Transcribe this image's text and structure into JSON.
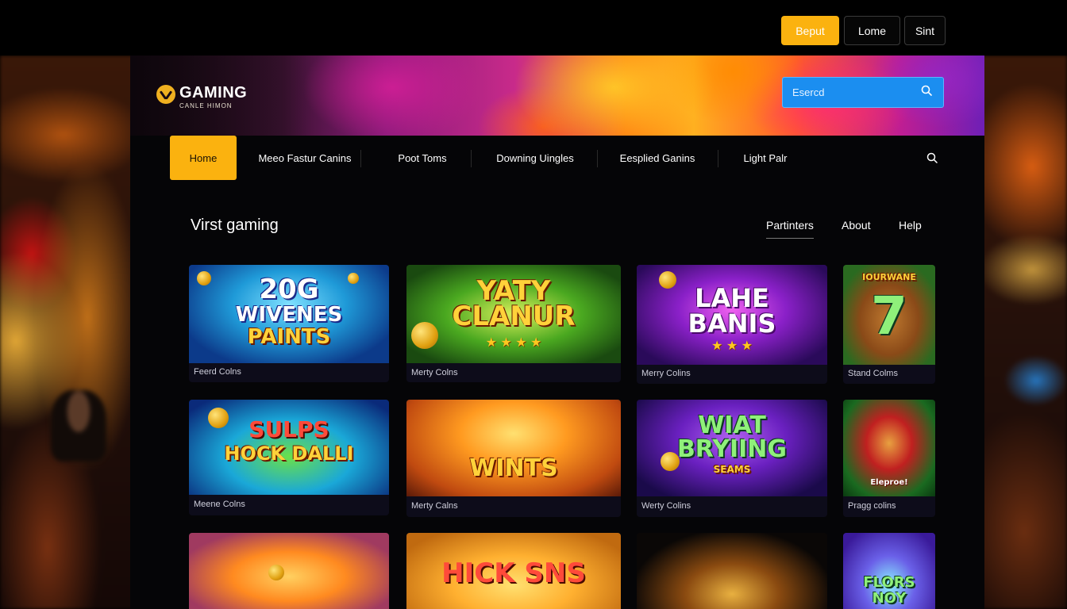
{
  "topbar": {
    "buttons": [
      "Beput",
      "Lome",
      "Sint"
    ]
  },
  "brand": {
    "title": "GAMING",
    "subtitle": "CANLE HIMON"
  },
  "search": {
    "placeholder": "Esercd"
  },
  "nav": {
    "items": [
      "Home",
      "Meeo Fastur Canins",
      "Poot Toms",
      "Downing Uingles",
      "Eesplied Ganins",
      "Light Palr"
    ],
    "active_index": 0
  },
  "section": {
    "title": "Virst gaming",
    "links": [
      "Partinters",
      "About",
      "Help"
    ]
  },
  "games": [
    {
      "art_lines": [
        "20G",
        "WIVENES",
        "PAINTS"
      ],
      "caption": "Feerd Colns"
    },
    {
      "art_lines": [
        "YATY",
        "CLANUR"
      ],
      "caption": "Merty Colns"
    },
    {
      "art_lines": [
        "LAHE",
        "BANIS"
      ],
      "caption": "Merry Colins"
    },
    {
      "art_lines": [
        "IOURWANE",
        "7"
      ],
      "caption": "Stand Colms"
    },
    {
      "art_lines": [
        "SULPS",
        "HOCK DALLI"
      ],
      "caption": "Meene Colns"
    },
    {
      "art_lines": [
        "WINTS"
      ],
      "caption": "Merty Calns"
    },
    {
      "art_lines": [
        "WIAT",
        "BRYIING",
        "SEAMS"
      ],
      "caption": "Werty Colins"
    },
    {
      "art_lines": [
        "Eleproe!"
      ],
      "caption": "Pragg colins"
    },
    {
      "art_lines": [],
      "caption": ""
    },
    {
      "art_lines": [
        "HICK SNS"
      ],
      "caption": ""
    },
    {
      "art_lines": [],
      "caption": ""
    },
    {
      "art_lines": [
        "FLORS",
        "NOY"
      ],
      "caption": ""
    }
  ],
  "colors": {
    "accent": "#fbb20f",
    "search_bg": "#1b8ef0",
    "panel_bg": "#050507",
    "card_bg": "#0d0c1a"
  }
}
